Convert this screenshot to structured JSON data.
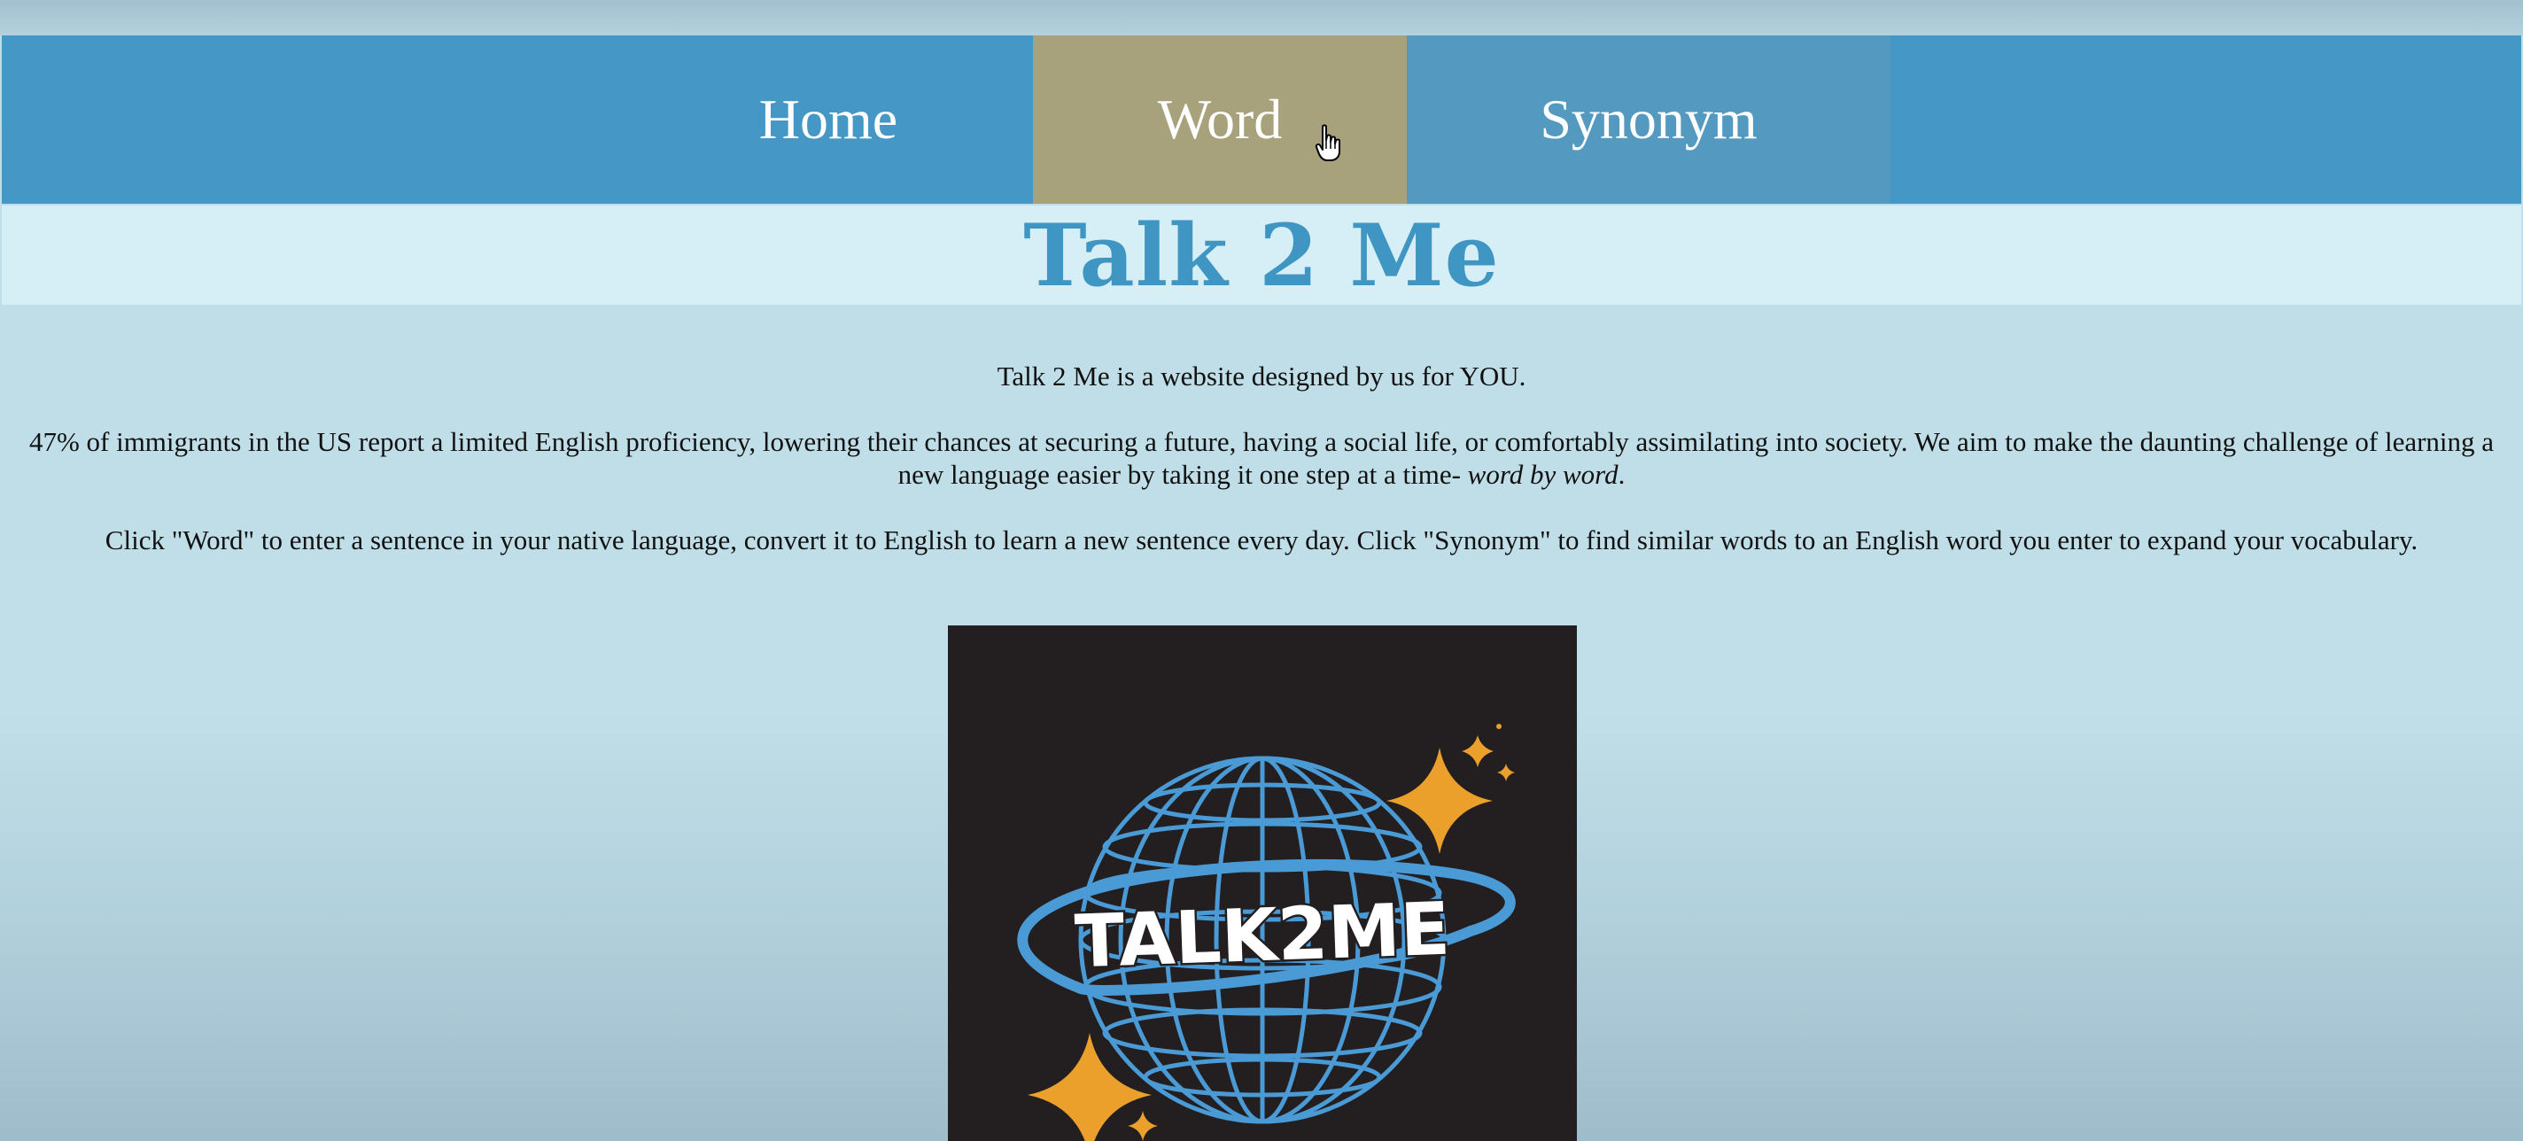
{
  "nav": {
    "items": [
      {
        "label": "Home",
        "state": "default"
      },
      {
        "label": "Word",
        "state": "hover"
      },
      {
        "label": "Synonym",
        "state": "default"
      }
    ]
  },
  "header": {
    "title": "Talk 2 Me"
  },
  "intro": {
    "line1": "Talk 2 Me is a website designed by us for YOU.",
    "paragraph2_text": "47% of immigrants in the US report a limited English proficiency, lowering their chances at securing a future, having a social life, or comfortably assimilating into society. We aim to make the daunting challenge of learning a new language easier by taking it one step at a time- ",
    "paragraph2_emphasis": "word by word",
    "paragraph2_end": ".",
    "line3": "Click \"Word\" to enter a sentence in your native language, convert it to English to learn a new sentence every day. Click \"Synonym\" to find similar words to an English word you enter to expand your vocabulary."
  },
  "logo": {
    "text": "TALK2ME",
    "icon": "globe-with-ring-and-stars",
    "colors": {
      "background": "#231f20",
      "globe": "#4a9ad6",
      "star": "#eba02c",
      "text": "#ffffff"
    }
  },
  "colors": {
    "nav_bg": "#4598c5",
    "nav_hover": "#a8a27c",
    "nav_synonym": "#5499c0",
    "title_band": "#d6eff6",
    "title_text": "#3f96c3"
  }
}
